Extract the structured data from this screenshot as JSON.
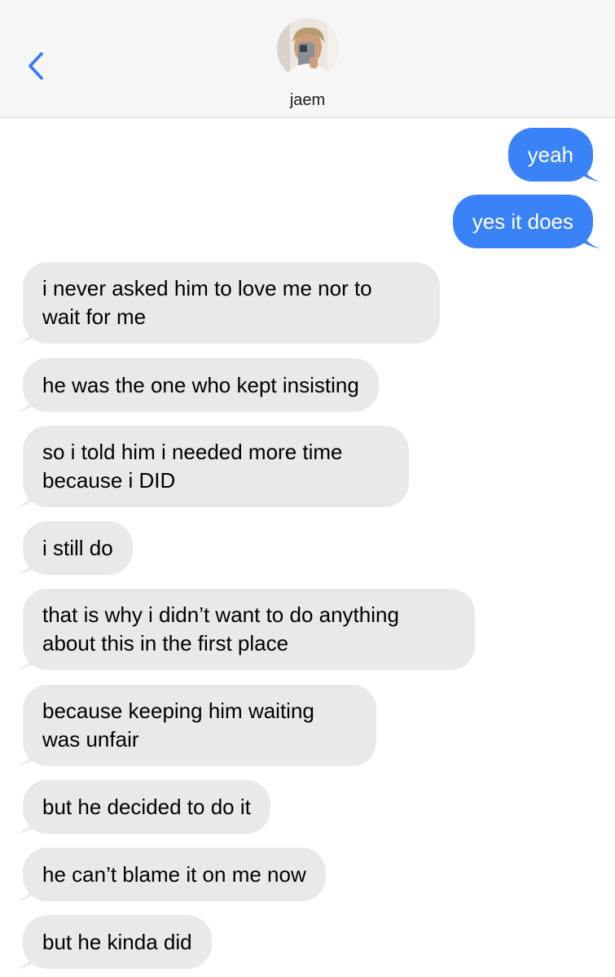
{
  "contact": {
    "name": "jaem"
  },
  "colors": {
    "sent": "#3a82f7",
    "received": "#e9e9eb",
    "accent": "#3478f6"
  },
  "icons": {
    "back": "chevron-left-icon"
  },
  "messages": [
    {
      "from": "me",
      "text": "yeah"
    },
    {
      "from": "me",
      "text": "yes it does"
    },
    {
      "from": "them",
      "text": "i never asked him to love me nor to\nwait for me"
    },
    {
      "from": "them",
      "text": "he was the one who kept insisting"
    },
    {
      "from": "them",
      "text": "so i told him i needed more time\nbecause i DID"
    },
    {
      "from": "them",
      "text": "i still do"
    },
    {
      "from": "them",
      "text": "that is why i didn’t want to do anything\nabout this in the first place"
    },
    {
      "from": "them",
      "text": "because keeping him waiting\nwas unfair"
    },
    {
      "from": "them",
      "text": "but he decided to do it"
    },
    {
      "from": "them",
      "text": "he can’t blame it on me now"
    },
    {
      "from": "them",
      "text": "but he kinda did"
    }
  ]
}
